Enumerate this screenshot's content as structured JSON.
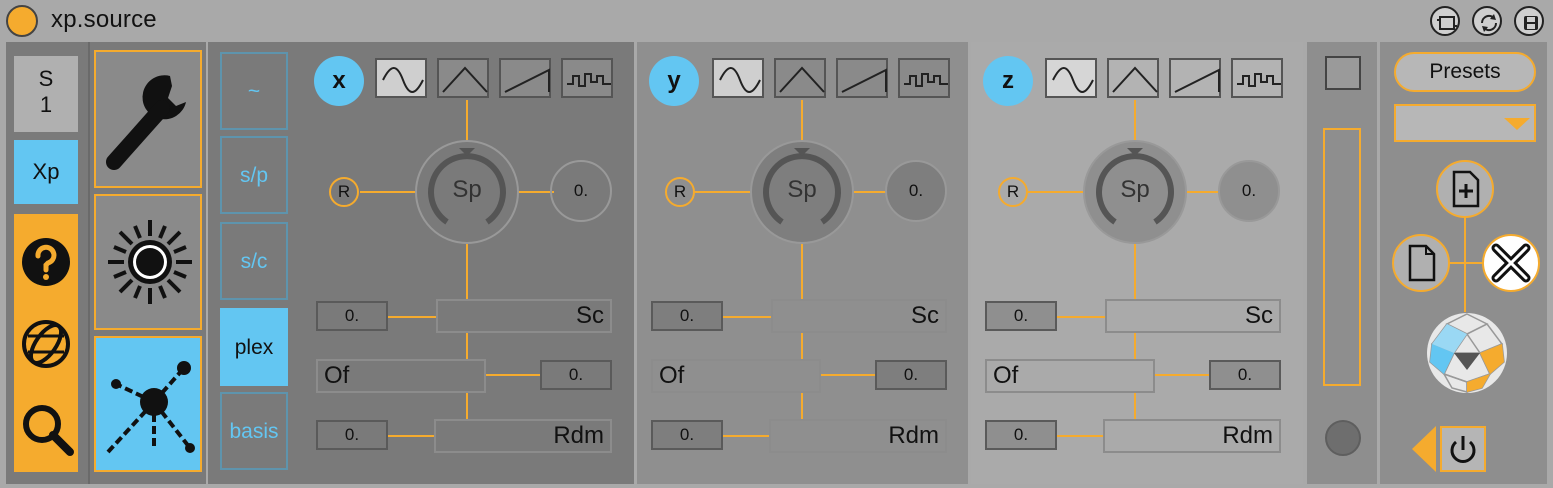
{
  "title": "xp.source",
  "title_buttons": [
    "freeze-icon",
    "refresh-icon",
    "save-icon"
  ],
  "left": {
    "s_label_line1": "S",
    "s_label_line2": "1",
    "xp_label": "Xp",
    "icons": [
      "help-icon",
      "globe-icon",
      "search-icon"
    ]
  },
  "mid": {
    "icons": [
      "wrench-icon",
      "sun-icon",
      "network-icon"
    ]
  },
  "modes": [
    {
      "label": "~",
      "active": false
    },
    {
      "label": "s/p",
      "active": false
    },
    {
      "label": "s/c",
      "active": false
    },
    {
      "label": "plex",
      "active": true
    },
    {
      "label": "basis",
      "active": false
    }
  ],
  "lfos": [
    {
      "letter": "x",
      "r_label": "R",
      "sp_label": "Sp",
      "sp_value": "0.",
      "sc_value": "0.",
      "sc_label": "Sc",
      "of_label": "Of",
      "of_value": "0.",
      "rdm_value": "0.",
      "rdm_label": "Rdm"
    },
    {
      "letter": "y",
      "r_label": "R",
      "sp_label": "Sp",
      "sp_value": "0.",
      "sc_value": "0.",
      "sc_label": "Sc",
      "of_label": "Of",
      "of_value": "0.",
      "rdm_value": "0.",
      "rdm_label": "Rdm"
    },
    {
      "letter": "z",
      "r_label": "R",
      "sp_label": "Sp",
      "sp_value": "0.",
      "sc_value": "0.",
      "sc_label": "Sc",
      "of_label": "Of",
      "of_value": "0.",
      "rdm_value": "0.",
      "rdm_label": "Rdm"
    }
  ],
  "waveforms": [
    "sine-wave-icon",
    "triangle-wave-icon",
    "saw-wave-icon",
    "random-step-icon"
  ],
  "presets": {
    "label": "Presets",
    "selected": ""
  },
  "colors": {
    "accent": "#f5ab2e",
    "blue": "#63c6f2"
  }
}
